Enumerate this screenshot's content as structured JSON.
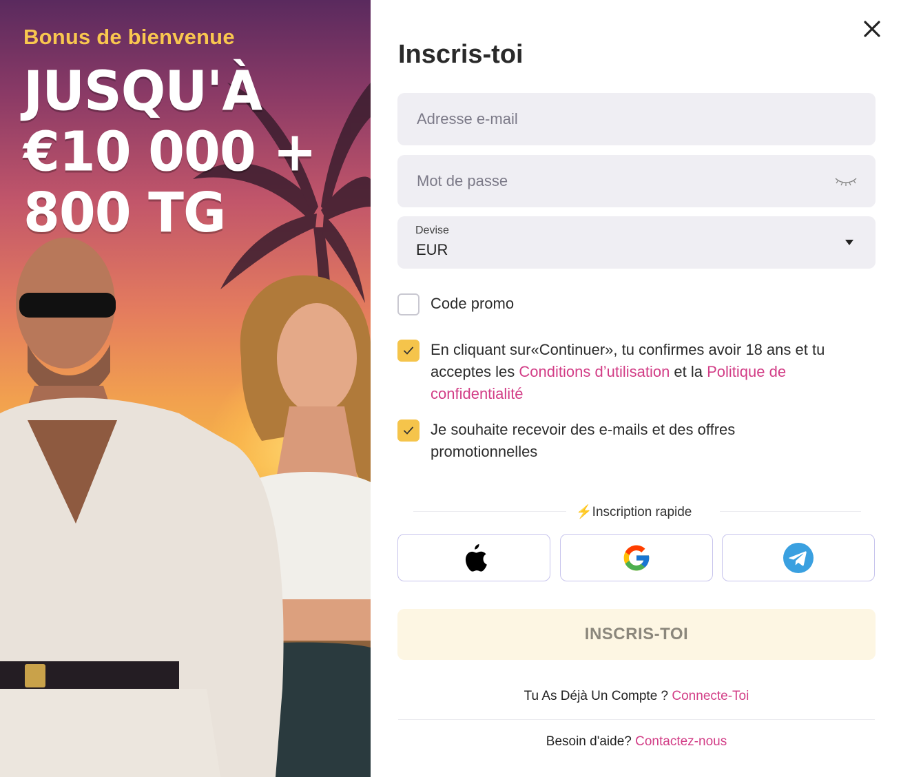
{
  "promo": {
    "bonus_label": "Bonus de bienvenue",
    "headline_lines": [
      "JUSQU'À",
      "€10 000 +",
      "800 TG"
    ]
  },
  "form": {
    "title": "Inscris-toi",
    "email_placeholder": "Adresse e-mail",
    "password_placeholder": "Mot de passe",
    "currency_label": "Devise",
    "currency_value": "EUR",
    "promo_code_label": "Code promo",
    "promo_code_checked": false,
    "terms": {
      "checked": true,
      "text_before": "En cliquant sur«Continuer», tu confirmes avoir 18 ans et tu acceptes les ",
      "terms_link": "Conditions d’utilisation",
      "text_middle": " et la ",
      "privacy_link": "Politique de confidentialité"
    },
    "marketing": {
      "checked": true,
      "text": "Je souhaite recevoir des e-mails et des offres promotionnelles"
    },
    "quick_signup": {
      "bolt": "⚡",
      "label": "Inscription rapide"
    },
    "social_buttons": [
      {
        "icon": "apple-icon"
      },
      {
        "icon": "google-icon"
      },
      {
        "icon": "telegram-icon"
      }
    ],
    "submit_label": "INSCRIS-TOI",
    "have_account_text": "Tu As Déjà Un Compte ?",
    "login_link": "Connecte-Toi",
    "help_text": "Besoin d'aide?",
    "contact_link": "Contactez-nous"
  },
  "colors": {
    "accent_link": "#d23d86",
    "checkbox_on": "#f5c44b",
    "bonus_yellow": "#f9c74f",
    "submit_bg": "#fdf6e3"
  }
}
